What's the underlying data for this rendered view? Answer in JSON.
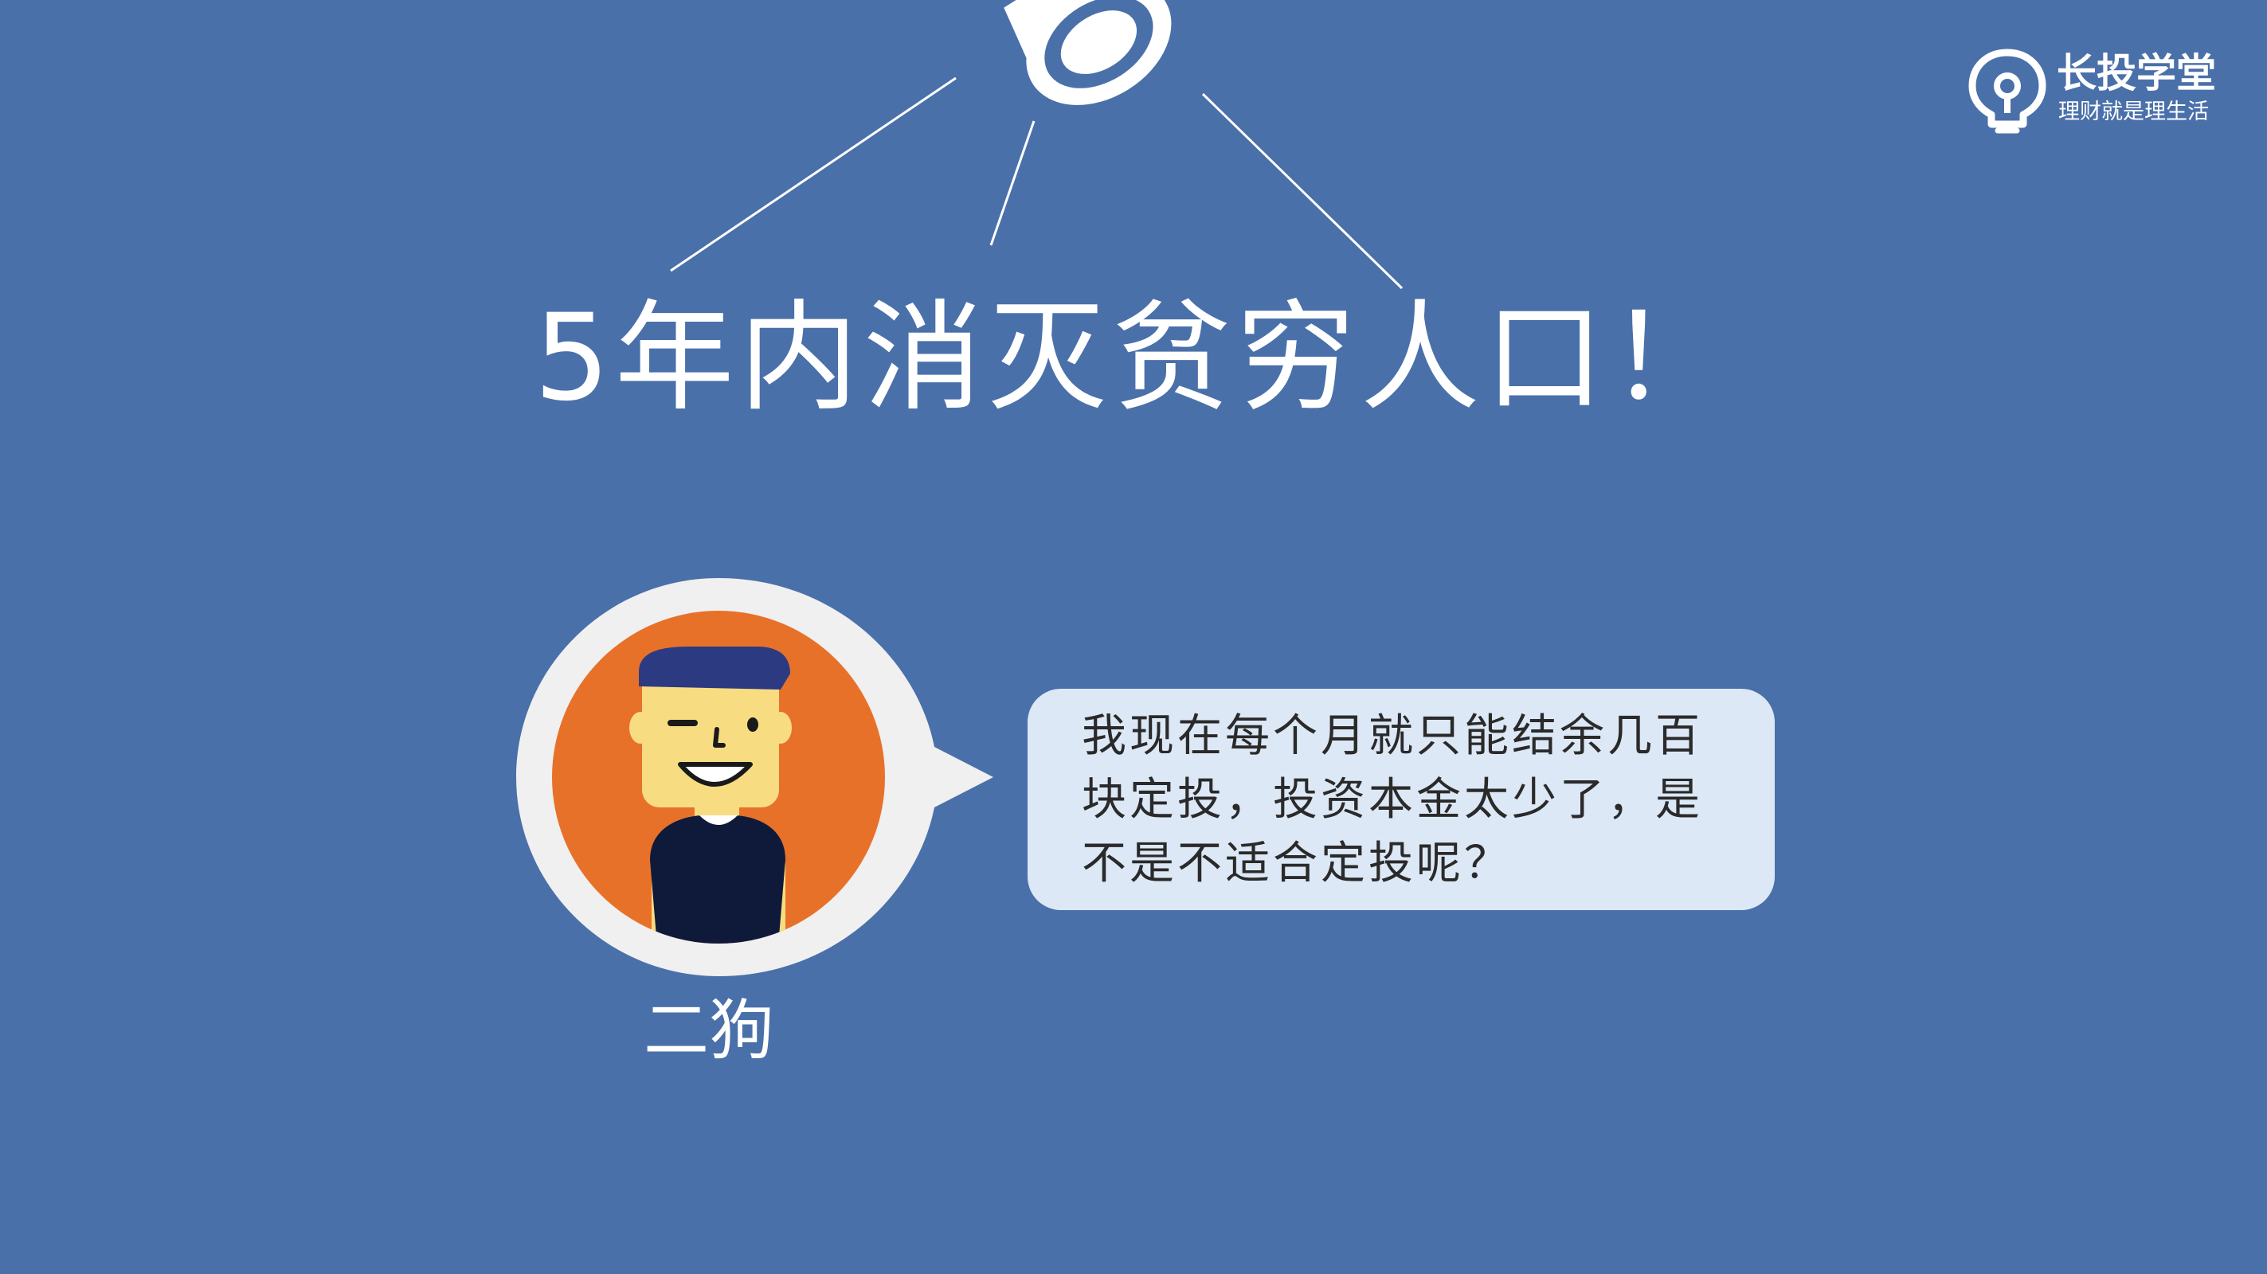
{
  "headline": "5年内消灭贫穷人口！",
  "logo": {
    "title": "长投学堂",
    "tagline": "理财就是理生活",
    "icon": "lightbulb-pin-icon"
  },
  "speaker": {
    "name": "二狗",
    "avatar": "cartoon-boy-winking-avatar"
  },
  "bubble": {
    "text": "我现在每个月就只能结余几百块定投，投资本金太少了，是不是不适合定投呢？"
  },
  "colors": {
    "background": "#4a70aa",
    "bubble": "#dde8f6",
    "avatar_circle": "#e8712a",
    "speaker_ring": "#f0f0f0",
    "hair": "#2c3a82",
    "skin": "#f8dc82",
    "shirt": "#0f1a3a"
  }
}
